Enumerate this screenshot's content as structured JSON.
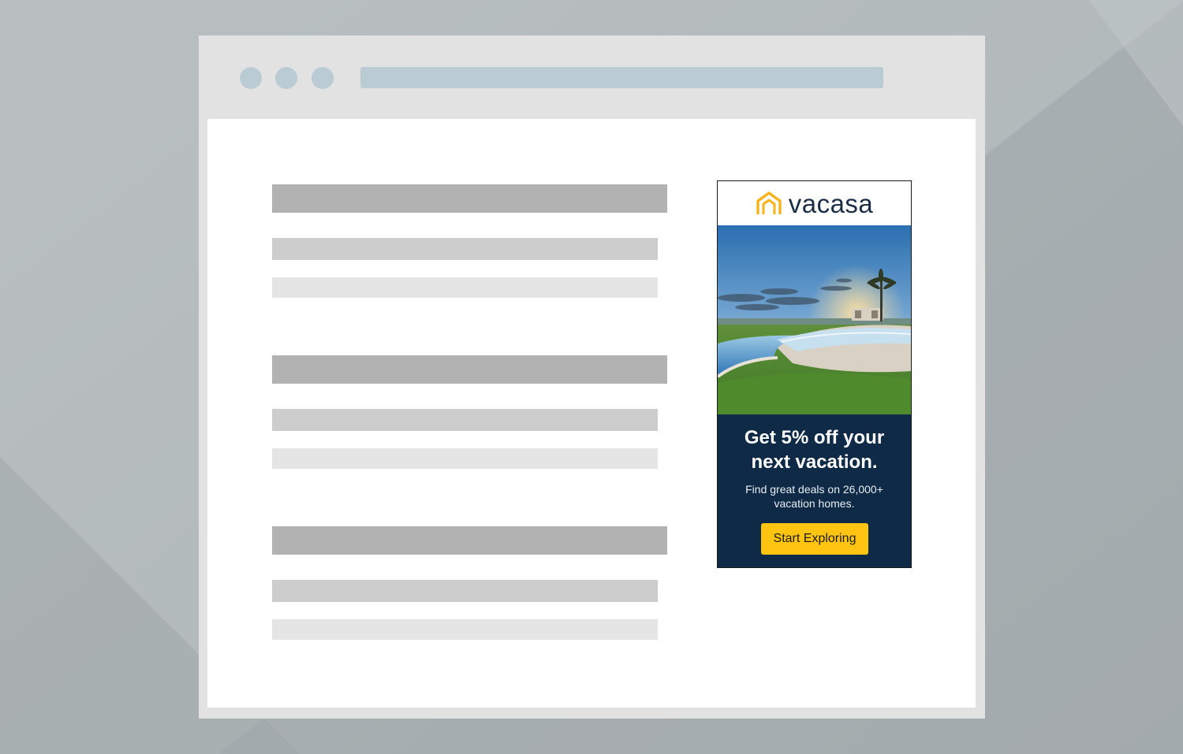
{
  "browser": {
    "window_controls": [
      "dot",
      "dot",
      "dot"
    ],
    "colors": {
      "chrome": "#e2e2e2",
      "placeholder": "#bacbd3",
      "page": "#ffffff"
    }
  },
  "content": {
    "sections": [
      {
        "kind": "text-placeholder"
      },
      {
        "kind": "text-placeholder"
      },
      {
        "kind": "text-placeholder"
      }
    ],
    "colors": {
      "heading": "#b2b2b2",
      "line1": "#cdcdcd",
      "line2": "#e5e5e5"
    }
  },
  "ad": {
    "logo": {
      "icon": "house-icon",
      "text": "vacasa",
      "icon_color": "#f9b31a"
    },
    "image": {
      "icon": "pool-sunset-photo"
    },
    "headline_line1": "Get 5% off your",
    "headline_line2": "next vacation.",
    "subtext_line1": "Find great deals on 26,000+",
    "subtext_line2": "vacation homes.",
    "cta_label": "Start Exploring",
    "colors": {
      "panel": "#0e2a47",
      "cta": "#ffc412",
      "logo_text": "#1b2e45"
    }
  }
}
